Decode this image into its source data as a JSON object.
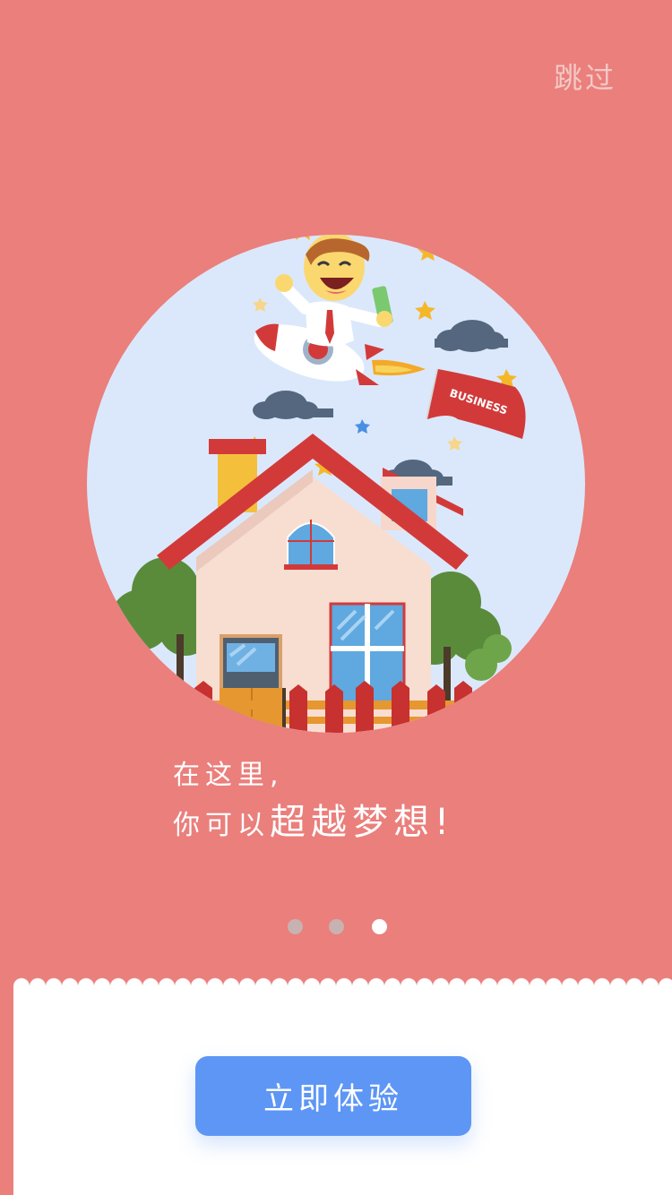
{
  "header": {
    "skip_label": "跳过"
  },
  "slide": {
    "line1": "在这里,",
    "line2_prefix": "你可以",
    "line2_emphasis": "超越梦想",
    "line2_suffix": "!",
    "flag_text": "BUSINESS"
  },
  "pager": {
    "total": 3,
    "active_index": 2
  },
  "cta": {
    "label": "立即体验"
  },
  "colors": {
    "background": "#ea7f7c",
    "circle": "#dbe8fb",
    "button": "#5d96f5",
    "roof": "#d23a3a",
    "dot_inactive": "#c7b2b1",
    "dot_active": "#ffffff"
  }
}
